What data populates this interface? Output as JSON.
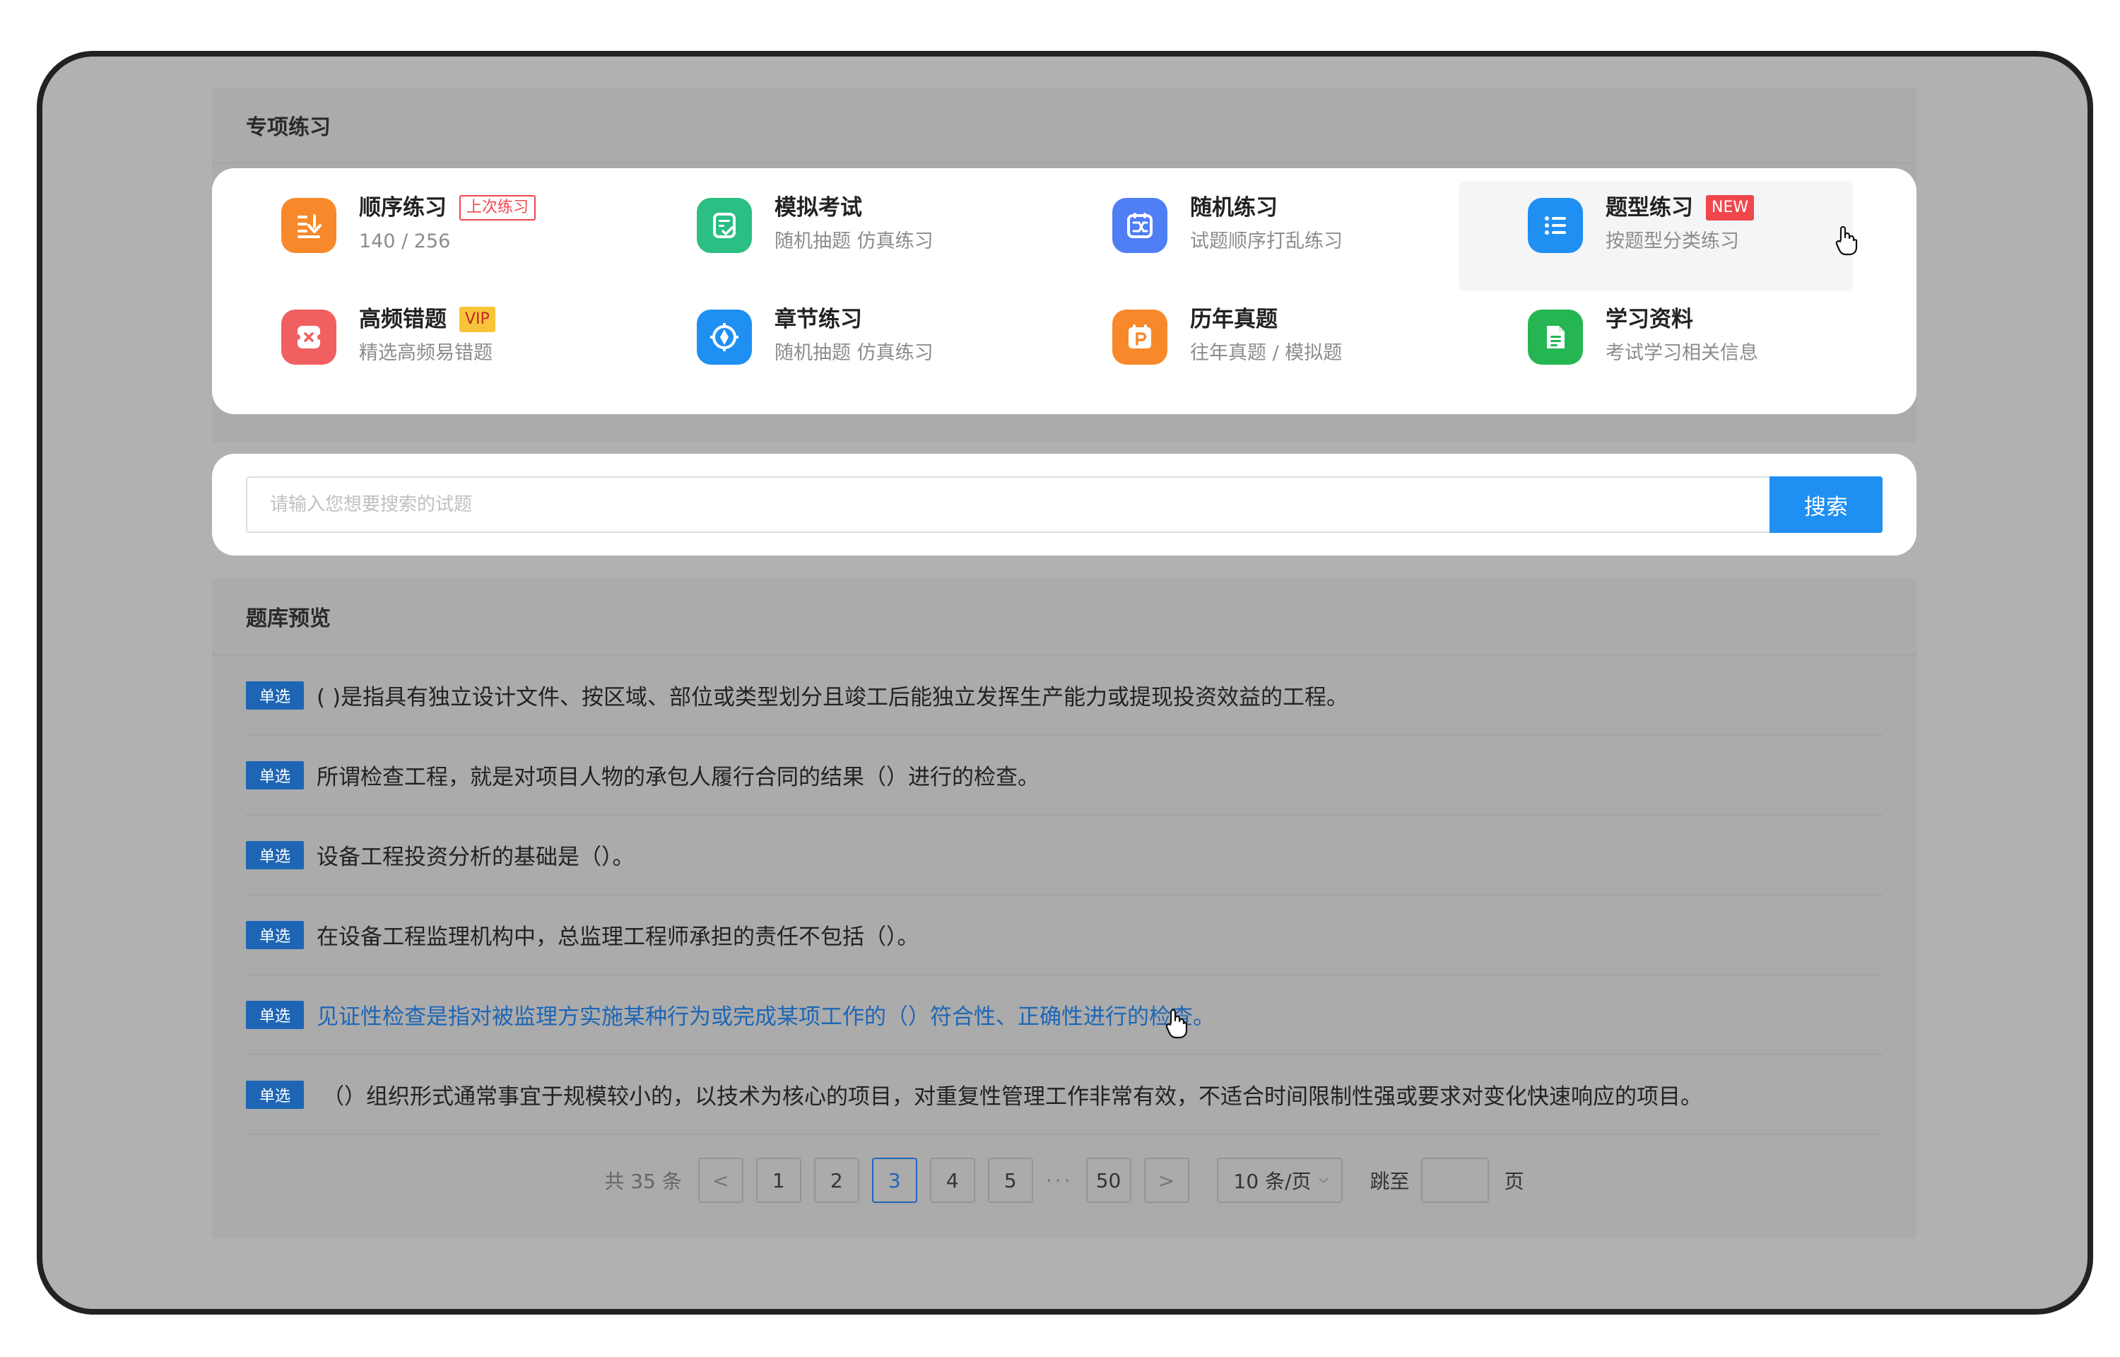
{
  "special": {
    "title": "专项练习",
    "tiles": [
      {
        "title": "顺序练习",
        "sub": "140 / 256",
        "tag": "上次练习",
        "tag_style": "last",
        "icon": "list-download-icon",
        "color": "#f7892a"
      },
      {
        "title": "模拟考试",
        "sub": "随机抽题 仿真练习",
        "tag": "",
        "icon": "checklist-doc-icon",
        "color": "#2bbf83"
      },
      {
        "title": "随机练习",
        "sub": "试题顺序打乱练习",
        "tag": "",
        "icon": "shuffle-icon",
        "color": "#4f7ef5"
      },
      {
        "title": "题型练习",
        "sub": "按题型分类练习",
        "tag": "NEW",
        "tag_style": "new",
        "icon": "bullet-list-icon",
        "color": "#1f8ff2"
      },
      {
        "title": "高频错题",
        "sub": "精选高频易错题",
        "tag": "VIP",
        "tag_style": "vip",
        "icon": "wrong-x-icon",
        "color": "#f06060"
      },
      {
        "title": "章节练习",
        "sub": "随机抽题 仿真练习",
        "tag": "",
        "icon": "compass-icon",
        "color": "#1f8ff2"
      },
      {
        "title": "历年真题",
        "sub": "往年真题 / 模拟题",
        "tag": "",
        "icon": "calendar-p-icon",
        "color": "#f7892a"
      },
      {
        "title": "学习资料",
        "sub": "考试学习相关信息",
        "tag": "",
        "icon": "document-icon",
        "color": "#25b552"
      }
    ]
  },
  "search": {
    "placeholder": "请输入您想要搜索的试题",
    "button": "搜索"
  },
  "bank": {
    "title": "题库预览",
    "badge": "单选",
    "questions": [
      "( )是指具有独立设计文件、按区域、部位或类型划分且竣工后能独立发挥生产能力或提现投资效益的工程。",
      "所谓检查工程，就是对项目人物的承包人履行合同的结果（）进行的检查。",
      "设备工程投资分析的基础是（）。",
      "在设备工程监理机构中，总监理工程师承担的责任不包括（）。",
      "见证性检查是指对被监理方实施某种行为或完成某项工作的（）符合性、正确性进行的检查。",
      "（）组织形式通常事宜于规模较小的，以技术为核心的项目，对重复性管理工作非常有效，不适合时间限制性强或要求对变化快速响应的项目。"
    ]
  },
  "pagination": {
    "total": "共 35 条",
    "prev": "<",
    "next": ">",
    "pages": [
      "1",
      "2",
      "3",
      "4",
      "5"
    ],
    "ellipsis": "···",
    "last": "50",
    "current": "3",
    "page_size": "10 条/页",
    "jump_label": "跳至",
    "page_unit": "页"
  }
}
